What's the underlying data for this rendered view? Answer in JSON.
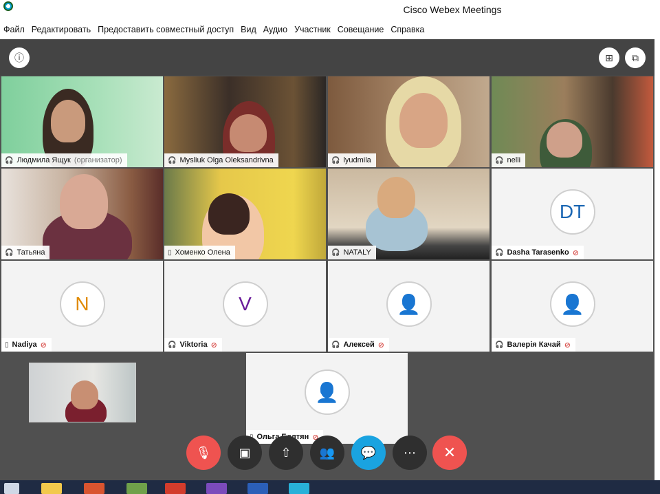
{
  "window": {
    "title": "Cisco Webex Meetings"
  },
  "menu": [
    "Файл",
    "Редактировать",
    "Предоставить совместный доступ",
    "Вид",
    "Аудио",
    "Участник",
    "Совещание",
    "Справка"
  ],
  "participants": [
    {
      "name": "Людмила Ящук",
      "role": "(организатор)",
      "muted": false,
      "avatar": ""
    },
    {
      "name": "Mysliuk Olga Oleksandrivna",
      "muted": false,
      "avatar": ""
    },
    {
      "name": "lyudmila",
      "muted": false,
      "avatar": ""
    },
    {
      "name": "nelli",
      "muted": false,
      "avatar": ""
    },
    {
      "name": "Татьяна",
      "muted": false,
      "avatar": ""
    },
    {
      "name": "Хоменко Олена",
      "muted": false,
      "avatar": ""
    },
    {
      "name": "NATALY",
      "muted": false,
      "avatar": ""
    },
    {
      "name": "Dasha Tarasenko",
      "muted": true,
      "avatar": "DT"
    },
    {
      "name": "Nadiya",
      "muted": true,
      "avatar": "N"
    },
    {
      "name": "Viktoria",
      "muted": true,
      "avatar": "V"
    },
    {
      "name": "Алексей",
      "muted": true,
      "avatar": "person"
    },
    {
      "name": "Валерія Качай",
      "muted": true,
      "avatar": "person"
    },
    {
      "name": "Ольга Болтян",
      "muted": true,
      "avatar": "person"
    }
  ],
  "colors": {
    "avatar_n": "#e08a00",
    "avatar_v": "#6a1b9a",
    "avatar_dt": "#1a66b3",
    "end_red": "#ef5350",
    "chat_blue": "#1aa3e0",
    "dark_btn": "#2f2f2f"
  },
  "controls": [
    "mute-icon",
    "stop-video-icon",
    "share-icon",
    "participants-icon",
    "chat-icon",
    "more-icon",
    "end-meeting-icon"
  ]
}
